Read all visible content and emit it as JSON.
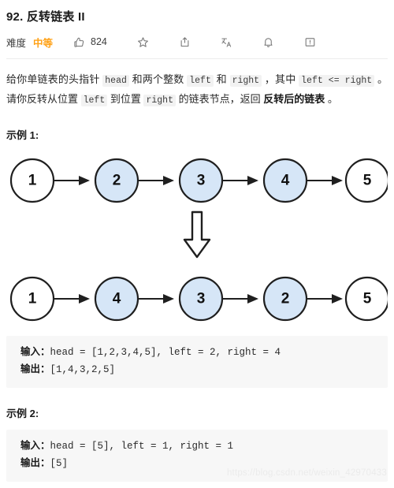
{
  "header": {
    "title": "92. 反转链表 II",
    "difficulty_label": "难度",
    "difficulty_value": "中等",
    "difficulty_color": "#FFA116",
    "like_count": "824",
    "icons": {
      "like": "thumbs-up-icon",
      "favorite": "star-icon",
      "share": "share-icon",
      "translate": "translate-icon",
      "notify": "bell-icon",
      "feedback": "feedback-icon"
    }
  },
  "description": {
    "seg1": "给你单链表的头指针 ",
    "code_head": "head",
    "seg2": " 和两个整数 ",
    "code_left1": "left",
    "seg3": " 和 ",
    "code_right1": "right",
    "seg4": " ，其中 ",
    "code_lte": "left <= right",
    "seg5": " 。请你反转从位置 ",
    "code_left2": "left",
    "seg6": " 到位置 ",
    "code_right2": "right",
    "seg7": " 的链表节点，返回 ",
    "bold": "反转后的链表",
    "seg8": " 。"
  },
  "examples": [
    {
      "heading": "示例 1:",
      "input_label": "输入：",
      "input_value": "head = [1,2,3,4,5], left = 2, right = 4",
      "output_label": "输出：",
      "output_value": "[1,4,3,2,5]"
    },
    {
      "heading": "示例 2:",
      "input_label": "输入：",
      "input_value": "head = [5], left = 1, right = 1",
      "output_label": "输出：",
      "output_value": "[5]"
    }
  ],
  "diagram": {
    "node_fill_highlight": "#d6e6f7",
    "node_fill_plain": "#ffffff",
    "node_stroke": "#1f1f1f",
    "before": {
      "caption": "input-linked-list",
      "nodes": [
        {
          "value": "1",
          "highlight": false
        },
        {
          "value": "2",
          "highlight": true
        },
        {
          "value": "3",
          "highlight": true
        },
        {
          "value": "4",
          "highlight": true
        },
        {
          "value": "5",
          "highlight": false
        }
      ]
    },
    "after": {
      "caption": "output-linked-list",
      "nodes": [
        {
          "value": "1",
          "highlight": false
        },
        {
          "value": "4",
          "highlight": true
        },
        {
          "value": "3",
          "highlight": true
        },
        {
          "value": "2",
          "highlight": true
        },
        {
          "value": "5",
          "highlight": false
        }
      ]
    }
  },
  "watermark": "https://blog.csdn.net/weixin_42970433"
}
